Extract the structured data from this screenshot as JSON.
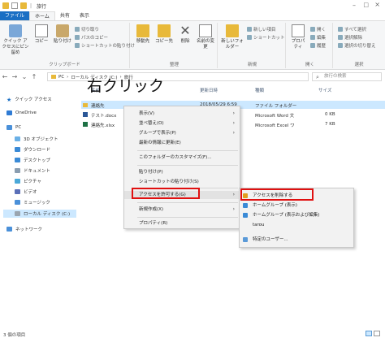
{
  "title": {
    "path_sep": "|",
    "folder_name": "旅行"
  },
  "tabs": [
    "ファイル",
    "ホーム",
    "共有",
    "表示"
  ],
  "ribbon": {
    "clipboard": {
      "pin_label": "クイック アクセスにピン留め",
      "copy_label": "コピー",
      "paste_label": "貼り付け",
      "cut_label": "切り取り",
      "copy_path_label": "パスのコピー",
      "paste_shortcut_label": "ショートカットの貼り付け",
      "group_label": "クリップボード"
    },
    "organize": {
      "move_label": "移動先",
      "copy_to_label": "コピー先",
      "delete_label": "削除",
      "rename_label": "名前の変更",
      "group_label": "整理"
    },
    "new": {
      "new_folder_label": "新しいフォルダー",
      "new_item_label": "新しい項目",
      "shortcut_label": "ショートカット",
      "group_label": "新規"
    },
    "open": {
      "properties_label": "プロパティ",
      "open_label": "開く",
      "edit_label": "編集",
      "history_label": "履歴",
      "group_label": "開く"
    },
    "select": {
      "select_all_label": "すべて選択",
      "select_none_label": "選択解除",
      "invert_label": "選択の切り替え",
      "group_label": "選択"
    }
  },
  "address": {
    "segments": [
      "PC",
      "ローカル ディスク (C:)",
      "旅行"
    ],
    "search_placeholder": "旅行の検索"
  },
  "annotation": "右クリック",
  "nav": {
    "quick_access": "クイック アクセス",
    "onedrive": "OneDrive",
    "pc": "PC",
    "items": [
      "3D オブジェクト",
      "ダウンロード",
      "デスクトップ",
      "ドキュメント",
      "ピクチャ",
      "ビデオ",
      "ミュージック",
      "ローカル ディスク (C:)"
    ],
    "network": "ネットワーク"
  },
  "list": {
    "headers": {
      "name": "名前",
      "date": "更新日時",
      "type": "種類",
      "size": "サイズ"
    },
    "rows": [
      {
        "name": "連絡先",
        "date": "2018/05/29 6:59",
        "type": "ファイル フォルダー",
        "size": ""
      },
      {
        "name": "テスト.docx",
        "date": "",
        "type": "Microsoft Word 文",
        "size": "0 KB"
      },
      {
        "name": "連絡先.xlsx",
        "date": "",
        "type": "Microsoft Excel ワ",
        "size": "7 KB"
      }
    ]
  },
  "context_menu": {
    "items": {
      "view": "表示(V)",
      "sort": "並べ替え(O)",
      "group": "グループで表示(P)",
      "refresh": "最新の情報に更新(E)",
      "customize": "このフォルダーのカスタマイズ(F)...",
      "paste": "貼り付け(P)",
      "paste_shortcut": "ショートカットの貼り付け(S)",
      "give_access": "アクセスを許可する(G)",
      "new": "新規作成(X)",
      "properties": "プロパティ(R)"
    }
  },
  "submenu": {
    "items": {
      "remove_access": "アクセスを削除する",
      "homegroup_view": "ホームグループ (表示)",
      "homegroup_edit": "ホームグループ (表示および編集)",
      "user": "tarou",
      "specific": "特定のユーザー..."
    }
  },
  "status": {
    "count_text": "3 個の項目"
  },
  "colors": {
    "accent": "#1a6fc4",
    "highlight_red": "#e01010",
    "selection": "#cce8ff",
    "folder": "#e8b93a"
  }
}
